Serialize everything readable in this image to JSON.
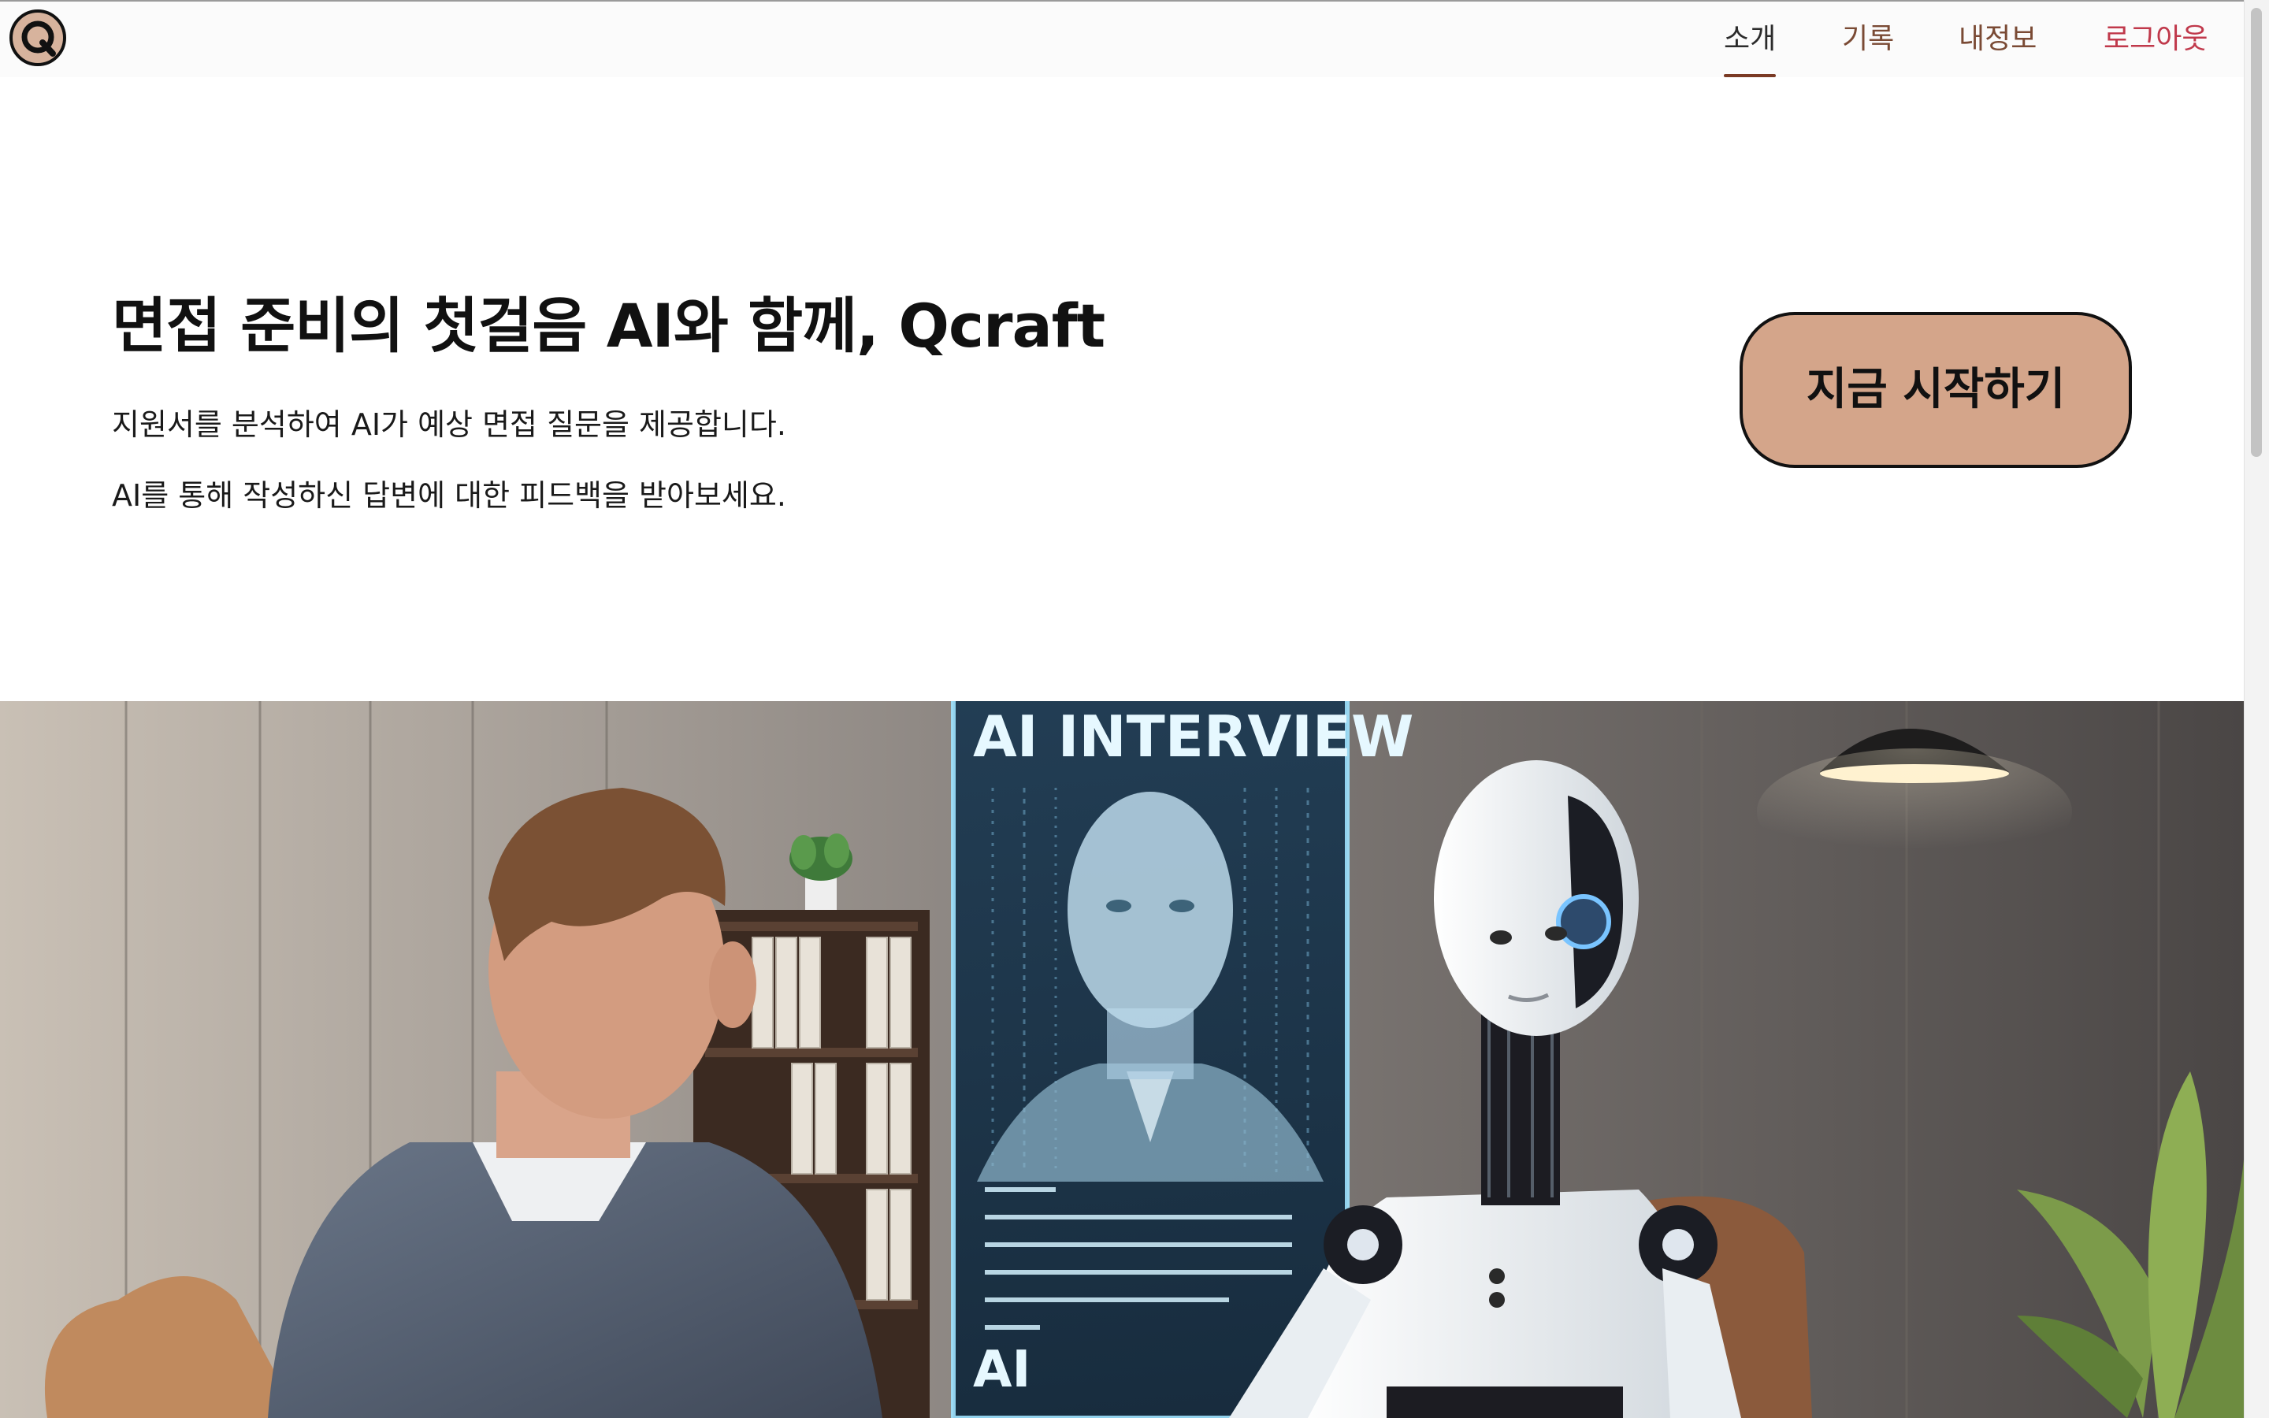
{
  "header": {
    "logo_icon": "q-logo-icon",
    "nav": [
      {
        "label": "소개",
        "active": true
      },
      {
        "label": "기록",
        "active": false
      },
      {
        "label": "내정보",
        "active": false
      },
      {
        "label": "로그아웃",
        "active": false
      }
    ]
  },
  "hero": {
    "title": "면접 준비의 첫걸음 AI와 함께, Qcraft",
    "description_1": "지원서를 분석하여 AI가 예상 면접 질문을 제공합니다.",
    "description_2": "AI를 통해 작성하신 답변에 대한 피드백을 받아보세요.",
    "cta_label": "지금 시작하기"
  },
  "banner": {
    "screen_heading": "AI INTERVIEW",
    "screen_footer": "AI"
  },
  "colors": {
    "accent": "#d4a58a",
    "nav_text": "#7a4a34",
    "logout": "#c0394b",
    "underline": "#7a3a24"
  }
}
